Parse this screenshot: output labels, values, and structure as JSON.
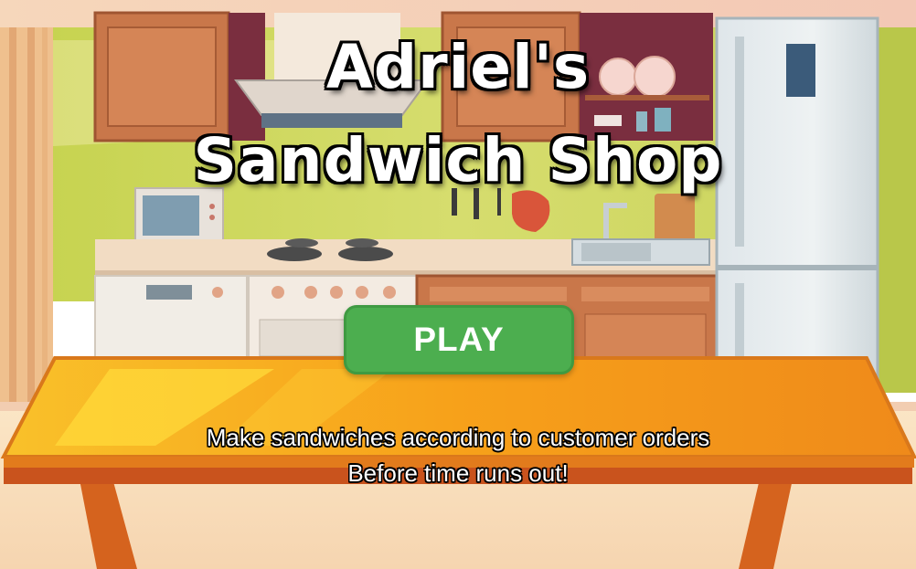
{
  "game": {
    "title_line1": "Adriel's",
    "title_line2": "Sandwich Shop",
    "play_label": "PLAY",
    "instruction_line1": "Make sandwiches according to customer orders",
    "instruction_line2": "Before time runs out!"
  },
  "colors": {
    "play_button": "#4cae4f",
    "table_top": "#f7a11a",
    "wall": "#b9cf3f"
  }
}
